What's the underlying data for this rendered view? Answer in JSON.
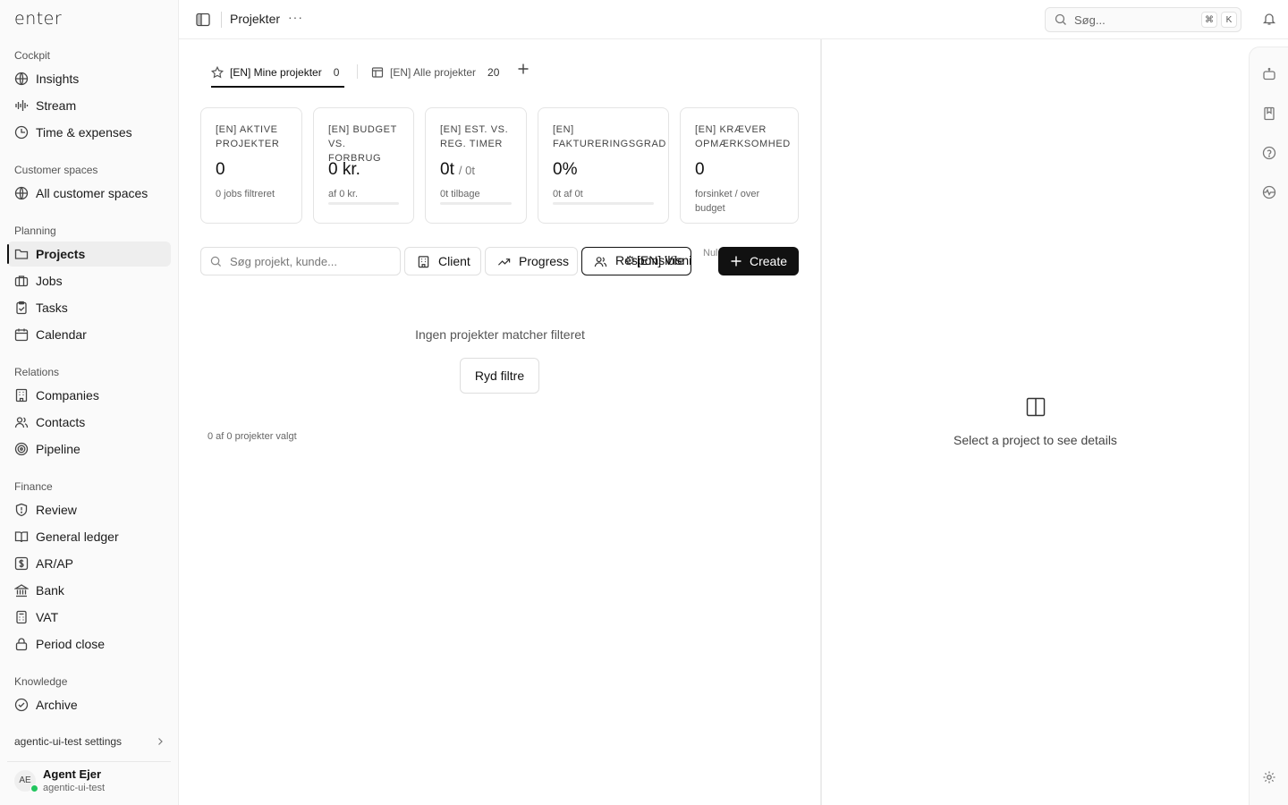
{
  "app": {
    "logo": "enter"
  },
  "sidebar": {
    "sections": [
      {
        "title": "Cockpit",
        "items": [
          {
            "label": "Insights",
            "icon": "globe-icon"
          },
          {
            "label": "Stream",
            "icon": "waveform-icon"
          },
          {
            "label": "Time & expenses",
            "icon": "clock-money-icon"
          }
        ]
      },
      {
        "title": "Customer spaces",
        "items": [
          {
            "label": "All customer spaces",
            "icon": "globe-icon"
          }
        ]
      },
      {
        "title": "Planning",
        "items": [
          {
            "label": "Projects",
            "icon": "folder-icon",
            "active": true
          },
          {
            "label": "Jobs",
            "icon": "briefcase-icon"
          },
          {
            "label": "Tasks",
            "icon": "clipboard-icon"
          },
          {
            "label": "Calendar",
            "icon": "calendar-icon"
          }
        ]
      },
      {
        "title": "Relations",
        "items": [
          {
            "label": "Companies",
            "icon": "building-icon"
          },
          {
            "label": "Contacts",
            "icon": "users-icon"
          },
          {
            "label": "Pipeline",
            "icon": "target-icon"
          }
        ]
      },
      {
        "title": "Finance",
        "items": [
          {
            "label": "Review",
            "icon": "shield-icon"
          },
          {
            "label": "General ledger",
            "icon": "book-icon"
          },
          {
            "label": "AR/AP",
            "icon": "dollar-square-icon"
          },
          {
            "label": "Bank",
            "icon": "bank-icon"
          },
          {
            "label": "VAT",
            "icon": "calculator-icon"
          },
          {
            "label": "Period close",
            "icon": "lock-icon"
          }
        ]
      },
      {
        "title": "Knowledge",
        "items": [
          {
            "label": "Archive",
            "icon": "archive-icon"
          }
        ]
      }
    ],
    "settings_label": "agentic-ui-test settings",
    "user": {
      "initials": "AE",
      "name": "Agent Ejer",
      "org": "agentic-ui-test",
      "status_color": "#22c55e"
    }
  },
  "topbar": {
    "title": "Projekter",
    "more": "···",
    "search_placeholder": "Søg...",
    "shortcut_keys": [
      "⌘",
      "K"
    ]
  },
  "tabs": [
    {
      "label": "[EN] Mine projekter",
      "count": "0",
      "icon": "star-icon",
      "active": true
    },
    {
      "label": "[EN] Alle projekter",
      "count": "20",
      "icon": "table-icon",
      "active": false
    }
  ],
  "cards": [
    {
      "title": "[EN] AKTIVE PROJEKTER",
      "value": "0",
      "value_sub": "",
      "note": "0 jobs filtreret",
      "has_bar": false,
      "progress": 0
    },
    {
      "title": "[EN] BUDGET VS. FORBRUG",
      "value": "0 kr.",
      "value_sub": "",
      "note": "af 0 kr.",
      "has_bar": true,
      "progress": 0
    },
    {
      "title": "[EN] EST. VS. REG. TIMER",
      "value": "0t",
      "value_sub": "/ 0t",
      "note": "0t tilbage",
      "has_bar": true,
      "progress": 0
    },
    {
      "title": "[EN] FAKTURERINGSGRAD",
      "value": "0%",
      "value_sub": "",
      "note": "0t af 0t",
      "has_bar": true,
      "progress": 0
    },
    {
      "title": "[EN] KRÆVER OPMÆRKSOMHED",
      "value": "0",
      "value_sub": "",
      "note": "forsinket / over budget",
      "has_bar": false,
      "progress": 0
    }
  ],
  "toolbar": {
    "search_placeholder": "Søg projekt, kunde...",
    "client_label": "Client",
    "progress_label": "Progress",
    "responsible_label": "Responsible",
    "overlap_label": "[EN] Visning",
    "overlap_icon_label": "⚙",
    "null_text": "Nul alle",
    "create_label": "Create"
  },
  "empty_state": {
    "message": "Ingen projekter matcher filteret",
    "clear_label": "Ryd filtre",
    "selection_count": "0 af 0 projekter valgt"
  },
  "detail": {
    "message": "Select a project to see details",
    "icon": "panel-icon"
  },
  "rail": {
    "icons": [
      "robot-icon",
      "bookmark-icon",
      "help-icon",
      "globe-pulse-icon",
      "settings-icon"
    ]
  },
  "colors": {
    "accent": "#111111",
    "online": "#22c55e",
    "border": "#e4e4e4"
  }
}
